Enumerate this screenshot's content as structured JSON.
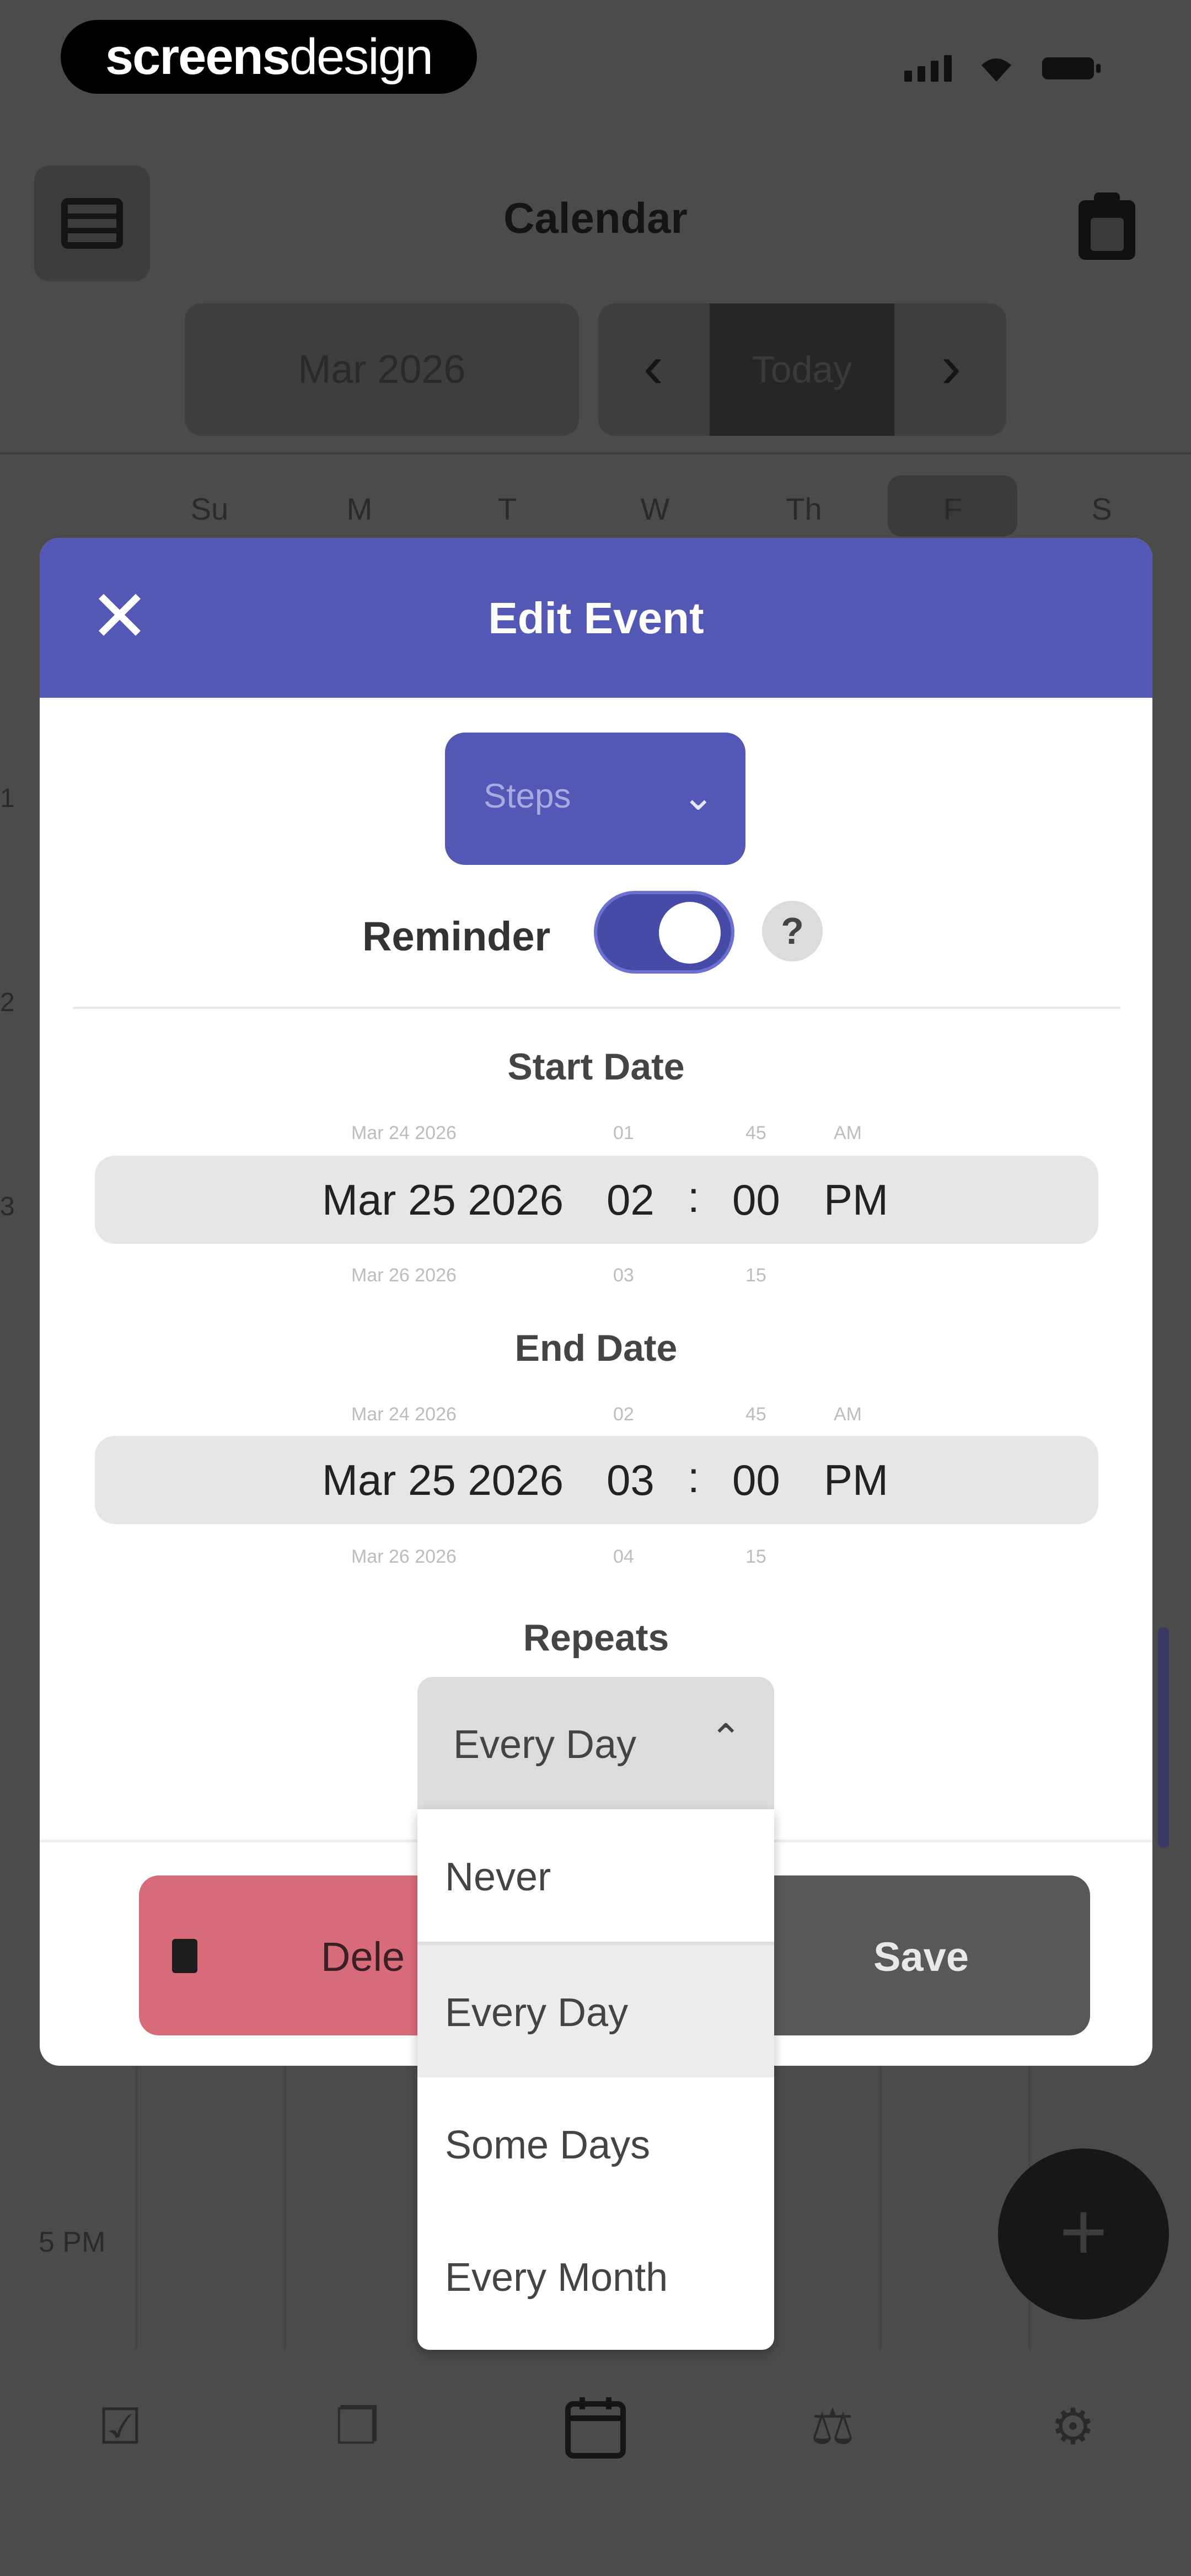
{
  "status": {
    "brand_bold": "screens",
    "brand_light": "design"
  },
  "calendar": {
    "title": "Calendar",
    "month": "Mar 2026",
    "today_label": "Today",
    "weekdays": [
      "Su",
      "M",
      "T",
      "W",
      "Th",
      "F",
      "S"
    ],
    "time_label": "5 PM",
    "side_hours": [
      "1",
      "2",
      "3"
    ]
  },
  "modal": {
    "title": "Edit Event",
    "type_select": "Steps",
    "reminder_label": "Reminder",
    "reminder_on": true,
    "help_label": "?",
    "start_label": "Start Date",
    "start": {
      "date": "Mar 25 2026",
      "hour": "02",
      "minute": "00",
      "ampm": "PM",
      "prev_date": "Mar 24 2026",
      "prev_hour": "01",
      "prev_minute": "45",
      "prev_ampm": "AM",
      "next_date": "Mar 26 2026",
      "next_hour": "03",
      "next_minute": "15"
    },
    "end_label": "End Date",
    "end": {
      "date": "Mar 25 2026",
      "hour": "03",
      "minute": "00",
      "ampm": "PM",
      "prev_date": "Mar 24 2026",
      "prev_hour": "02",
      "prev_minute": "45",
      "prev_ampm": "AM",
      "next_date": "Mar 26 2026",
      "next_hour": "04",
      "next_minute": "15"
    },
    "repeats_label": "Repeats",
    "repeats_value": "Every Day",
    "repeat_options": [
      "Never",
      "Every Day",
      "Some Days",
      "Every Month"
    ],
    "delete_label": "Dele",
    "save_label": "Save"
  },
  "colors": {
    "accent": "#5357b6",
    "delete": "#d86b79",
    "save": "#585858"
  }
}
